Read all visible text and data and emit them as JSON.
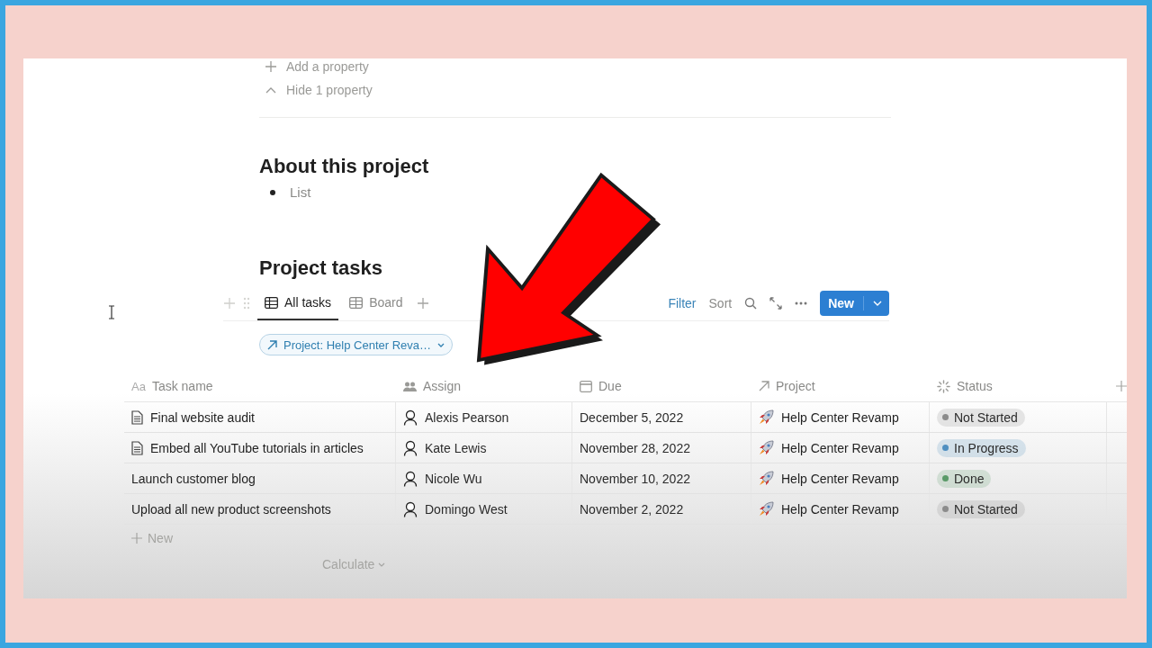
{
  "properties": [
    {
      "kind": "add",
      "label": "Add a property"
    },
    {
      "kind": "hide",
      "label": "Hide 1 property"
    }
  ],
  "about": {
    "heading": "About this project",
    "bullets": [
      "List"
    ]
  },
  "tasks": {
    "heading": "Project tasks",
    "views": [
      {
        "label": "All tasks",
        "kind": "table",
        "selected": true
      },
      {
        "label": "Board",
        "kind": "board",
        "selected": false
      }
    ],
    "toolbar": {
      "filter": "Filter",
      "sort": "Sort",
      "new": "New"
    },
    "filter_chip": "Project: Help Center Reva…",
    "columns": [
      {
        "kind": "title",
        "glyph": "Aa",
        "label": "Task name"
      },
      {
        "kind": "person",
        "label": "Assign"
      },
      {
        "kind": "date",
        "label": "Due"
      },
      {
        "kind": "relation",
        "label": "Project"
      },
      {
        "kind": "status",
        "label": "Status"
      }
    ],
    "rows": [
      {
        "has_page": true,
        "name": "Final website audit",
        "assign": "Alexis Pearson",
        "due": "December 5, 2022",
        "project": "Help Center Revamp",
        "status": {
          "label": "Not Started",
          "color": "#8c8c8c"
        }
      },
      {
        "has_page": true,
        "name": "Embed all YouTube tutorials in articles",
        "assign": "Kate Lewis",
        "due": "November 28, 2022",
        "project": "Help Center Revamp",
        "status": {
          "label": "In Progress",
          "color": "#4f8fc0"
        }
      },
      {
        "has_page": false,
        "name": "Launch customer blog",
        "assign": "Nicole Wu",
        "due": "November 10, 2022",
        "project": "Help Center Revamp",
        "status": {
          "label": "Done",
          "color": "#5a9a68"
        }
      },
      {
        "has_page": false,
        "name": "Upload all new product screenshots",
        "assign": "Domingo West",
        "due": "November 2, 2022",
        "project": "Help Center Revamp",
        "status": {
          "label": "Not Started",
          "color": "#8c8c8c"
        }
      }
    ],
    "new_row": "New",
    "calculate": "Calculate"
  }
}
